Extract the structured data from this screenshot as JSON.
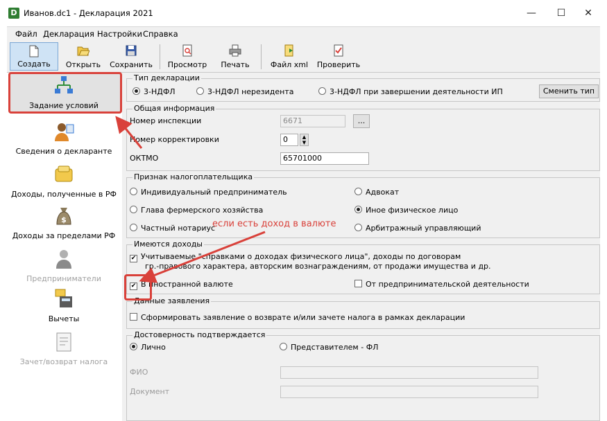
{
  "window": {
    "title": "Иванов.dc1 - Декларация 2021",
    "app_icon": "D",
    "controls": {
      "minimize": "—",
      "maximize": "☐",
      "close": "✕"
    }
  },
  "menu": [
    "Файл",
    "Декларация",
    "Настройки",
    "Справка"
  ],
  "toolbar": [
    {
      "label": "Создать",
      "icon": "new-document-icon"
    },
    {
      "label": "Открыть",
      "icon": "open-folder-icon"
    },
    {
      "label": "Сохранить",
      "icon": "save-disk-icon"
    },
    {
      "label": "Просмотр",
      "icon": "preview-icon"
    },
    {
      "label": "Печать",
      "icon": "printer-icon"
    },
    {
      "label": "Файл xml",
      "icon": "xml-file-icon"
    },
    {
      "label": "Проверить",
      "icon": "check-document-icon"
    }
  ],
  "nav": [
    {
      "label": "Задание условий",
      "icon": "conditions-tree-icon",
      "enabled": true
    },
    {
      "label": "Сведения о декларанте",
      "icon": "person-icon",
      "enabled": true
    },
    {
      "label": "Доходы, полученные в РФ",
      "icon": "coins-icon",
      "enabled": true
    },
    {
      "label": "Доходы за пределами РФ",
      "icon": "money-bag-icon",
      "enabled": true
    },
    {
      "label": "Предприниматели",
      "icon": "entrepreneur-icon",
      "enabled": false
    },
    {
      "label": "Вычеты",
      "icon": "deductions-icon",
      "enabled": true
    },
    {
      "label": "Зачет/возврат налога",
      "icon": "refund-document-icon",
      "enabled": false
    }
  ],
  "declaration_type": {
    "title": "Тип декларации",
    "options": [
      "3-НДФЛ",
      "3-НДФЛ нерезидента",
      "3-НДФЛ при завершении деятельности ИП"
    ],
    "selected": "3-НДФЛ",
    "change_button": "Сменить тип"
  },
  "general": {
    "title": "Общая информация",
    "inspection_label": "Номер инспекции",
    "inspection_value": "6671",
    "browse_button": "...",
    "correction_label": "Номер корректировки",
    "correction_value": "0",
    "oktmo_label": "ОКТМО",
    "oktmo_value": "65701000"
  },
  "taxpayer": {
    "title": "Признак налогоплательщика",
    "options": [
      "Индивидуальный предприниматель",
      "Адвокат",
      "Глава фермерского хозяйства",
      "Иное физическое лицо",
      "Частный нотариус",
      "Арбитражный управляющий"
    ],
    "selected": "Иное физическое лицо"
  },
  "income": {
    "title": "Имеются доходы",
    "certified_line1": "Учитываемые \"справками о доходах физического лица\", доходы по договорам",
    "certified_line2": "гр.-правового характера, авторским вознаграждениям, от продажи имущества и др.",
    "certified_checked": true,
    "foreign_label": "В иностранной валюте",
    "foreign_checked": true,
    "business_label": "От предпринимательской деятельности",
    "business_checked": false
  },
  "application": {
    "title": "Данные заявления",
    "label": "Сформировать заявление о  возврате и/или зачете налога в рамках декларации",
    "checked": false
  },
  "authenticity": {
    "title": "Достоверность подтверждается",
    "options": [
      "Лично",
      "Представителем - ФЛ"
    ],
    "selected": "Лично",
    "fio_label": "ФИО",
    "doc_label": "Документ"
  },
  "annotation": {
    "text": "если есть доход в валюте",
    "color": "#d9413a"
  }
}
